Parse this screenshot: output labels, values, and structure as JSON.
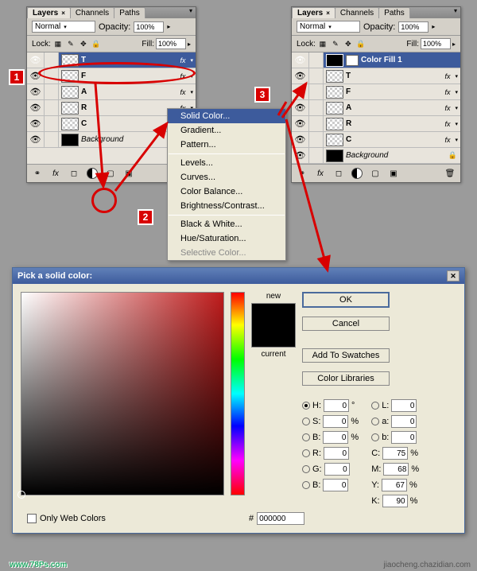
{
  "panel_left": {
    "tabs": [
      "Layers",
      "Channels",
      "Paths"
    ],
    "blend_mode": "Normal",
    "opacity_label": "Opacity:",
    "opacity_value": "100%",
    "lock_label": "Lock:",
    "fill_label": "Fill:",
    "fill_value": "100%",
    "layers": [
      {
        "name": "T",
        "fx": "fx",
        "selected": true
      },
      {
        "name": "F",
        "fx": "fx"
      },
      {
        "name": "A",
        "fx": "fx"
      },
      {
        "name": "R",
        "fx": "fx"
      },
      {
        "name": "C",
        "fx": "fx"
      },
      {
        "name": "Background",
        "thumb": "black",
        "lock": true
      }
    ]
  },
  "panel_right": {
    "tabs": [
      "Layers",
      "Channels",
      "Paths"
    ],
    "blend_mode": "Normal",
    "opacity_label": "Opacity:",
    "opacity_value": "100%",
    "lock_label": "Lock:",
    "fill_label": "Fill:",
    "fill_value": "100%",
    "layers": [
      {
        "name": "Color Fill 1",
        "selected": true,
        "fill": true
      },
      {
        "name": "T",
        "fx": "fx"
      },
      {
        "name": "F",
        "fx": "fx"
      },
      {
        "name": "A",
        "fx": "fx"
      },
      {
        "name": "R",
        "fx": "fx"
      },
      {
        "name": "C",
        "fx": "fx"
      },
      {
        "name": "Background",
        "thumb": "black",
        "lock": true
      }
    ]
  },
  "context_menu": {
    "items": [
      {
        "label": "Solid Color...",
        "selected": true
      },
      {
        "label": "Gradient..."
      },
      {
        "label": "Pattern..."
      },
      {
        "sep": true
      },
      {
        "label": "Levels..."
      },
      {
        "label": "Curves..."
      },
      {
        "label": "Color Balance..."
      },
      {
        "label": "Brightness/Contrast..."
      },
      {
        "sep": true
      },
      {
        "label": "Black & White..."
      },
      {
        "label": "Hue/Saturation..."
      },
      {
        "label": "Selective Color...",
        "disabled": true
      }
    ]
  },
  "dialog": {
    "title": "Pick a solid color:",
    "new_label": "new",
    "current_label": "current",
    "ok": "OK",
    "cancel": "Cancel",
    "add_swatches": "Add To Swatches",
    "color_libraries": "Color Libraries",
    "H_label": "H:",
    "H_val": "0",
    "H_unit": "°",
    "S_label": "S:",
    "S_val": "0",
    "S_unit": "%",
    "Bv_label": "B:",
    "Bv_val": "0",
    "Bv_unit": "%",
    "L_label": "L:",
    "L_val": "0",
    "a_label": "a:",
    "a_val": "0",
    "b_label": "b:",
    "b_val": "0",
    "R_label": "R:",
    "R_val": "0",
    "G_label": "G:",
    "G_val": "0",
    "B_label": "B:",
    "B_val": "0",
    "C_label": "C:",
    "C_val": "75",
    "C_unit": "%",
    "M_label": "M:",
    "M_val": "68",
    "M_unit": "%",
    "Y_label": "Y:",
    "Y_val": "67",
    "Y_unit": "%",
    "K_label": "K:",
    "K_val": "90",
    "K_unit": "%",
    "hex_label": "#",
    "hex_val": "000000",
    "web_colors": "Only Web Colors"
  },
  "markers": {
    "1": "1",
    "2": "2",
    "3": "3"
  },
  "watermark_left": "www.78Ps.com",
  "watermark_right": "jiaocheng.chazidian.com"
}
